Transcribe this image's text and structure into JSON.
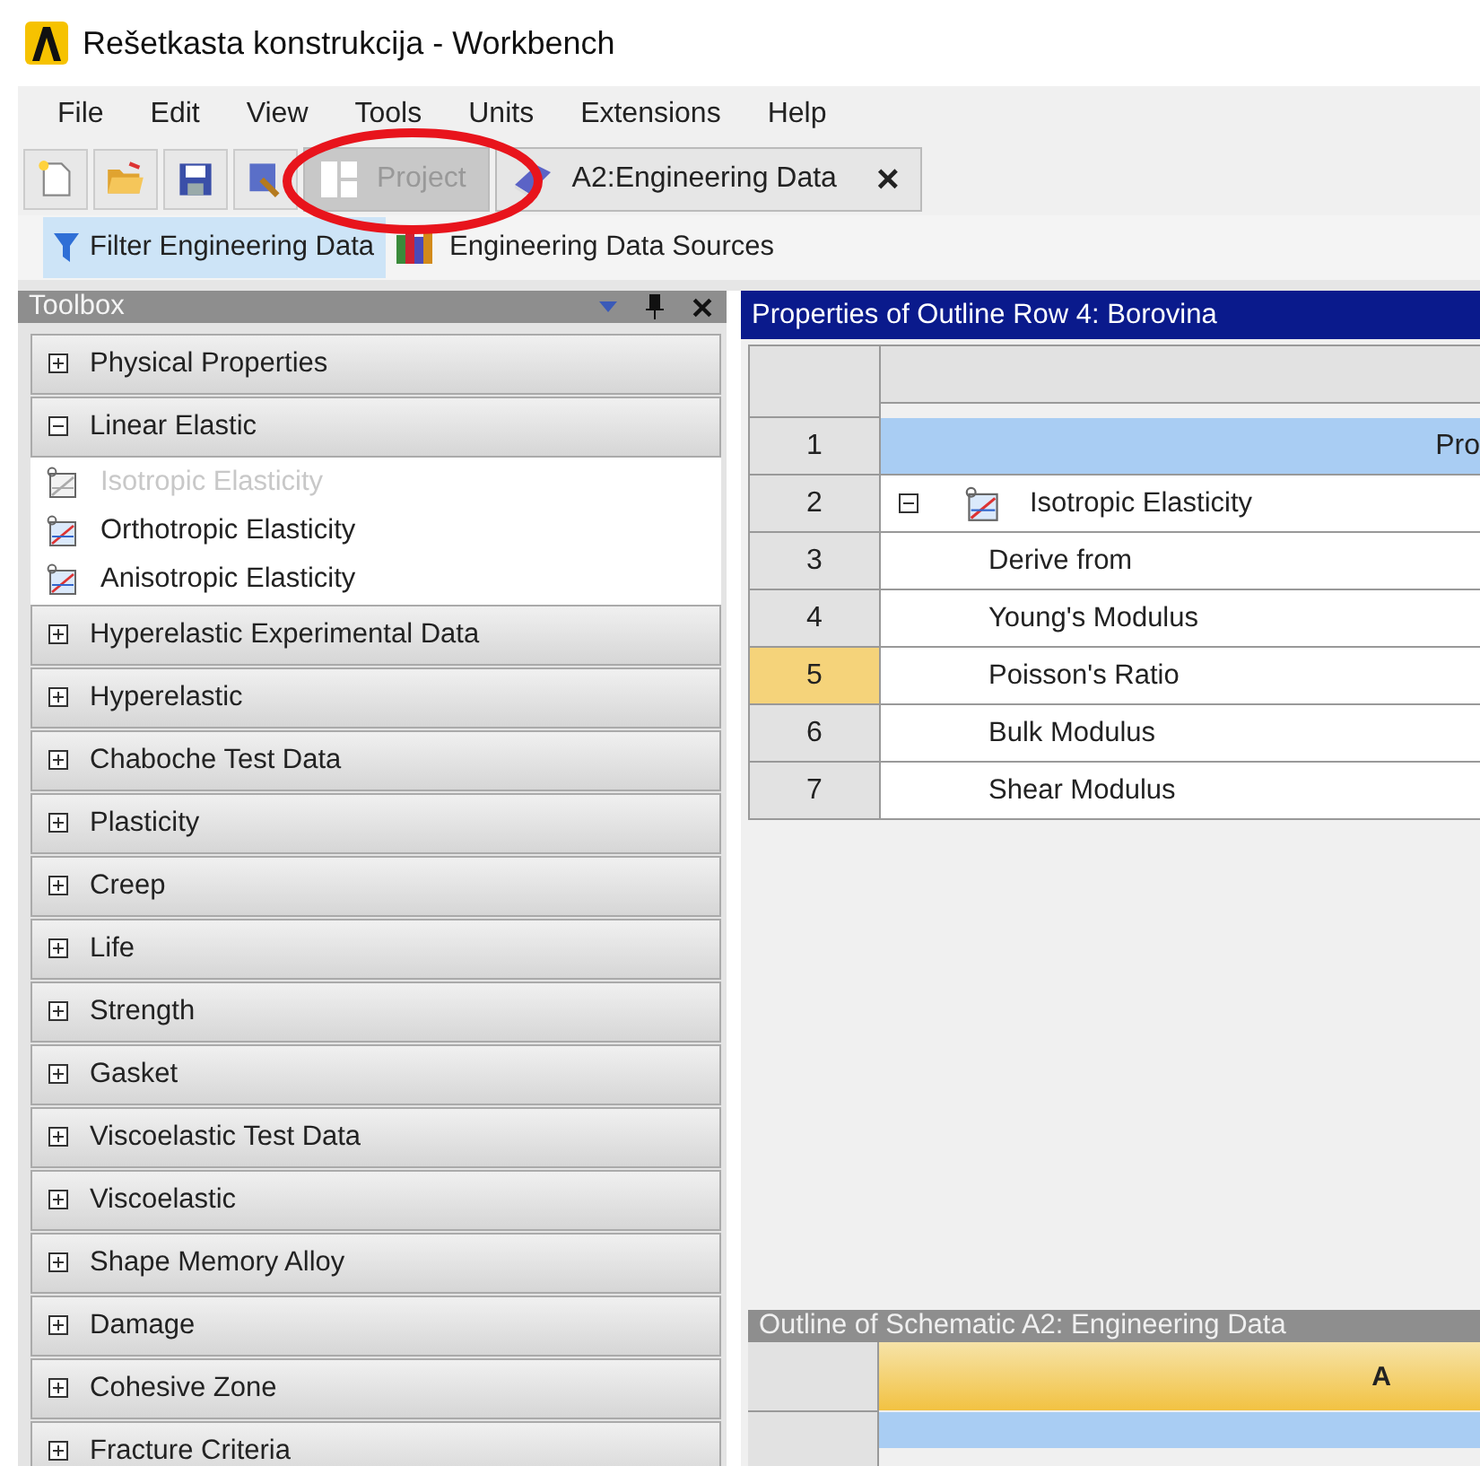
{
  "window": {
    "title": "Rešetkasta konstrukcija - Workbench"
  },
  "menu": [
    "File",
    "Edit",
    "View",
    "Tools",
    "Units",
    "Extensions",
    "Help"
  ],
  "toolbar": {
    "buttons": [
      {
        "kind": "new"
      },
      {
        "kind": "open"
      },
      {
        "kind": "save"
      },
      {
        "kind": "import"
      }
    ],
    "tabs": [
      {
        "label": "Project",
        "selected": false,
        "kind": "project"
      },
      {
        "label": "A2:Engineering Data",
        "selected": true,
        "close": "×",
        "kind": "book"
      }
    ]
  },
  "annotation": {
    "kind": "ellipse"
  },
  "subtoolbar": [
    {
      "label": "Filter Engineering Data",
      "on": true,
      "kind": "filter"
    },
    {
      "label": "Engineering Data Sources",
      "on": false,
      "kind": "books"
    }
  ],
  "toolbox": {
    "title": "Toolbox",
    "items": [
      {
        "kind": "category",
        "label": "Physical Properties",
        "expanded": false
      },
      {
        "kind": "category",
        "label": "Linear Elastic",
        "expanded": true
      },
      {
        "kind": "item",
        "label": "Isotropic Elasticity",
        "disabled": true
      },
      {
        "kind": "item",
        "label": "Orthotropic Elasticity",
        "disabled": false
      },
      {
        "kind": "item",
        "label": "Anisotropic Elasticity",
        "disabled": false
      },
      {
        "kind": "category",
        "label": "Hyperelastic Experimental Data",
        "expanded": false
      },
      {
        "kind": "category",
        "label": "Hyperelastic",
        "expanded": false
      },
      {
        "kind": "category",
        "label": "Chaboche Test Data",
        "expanded": false
      },
      {
        "kind": "category",
        "label": "Plasticity",
        "expanded": false
      },
      {
        "kind": "category",
        "label": "Creep",
        "expanded": false
      },
      {
        "kind": "category",
        "label": "Life",
        "expanded": false
      },
      {
        "kind": "category",
        "label": "Strength",
        "expanded": false
      },
      {
        "kind": "category",
        "label": "Gasket",
        "expanded": false
      },
      {
        "kind": "category",
        "label": "Viscoelastic Test Data",
        "expanded": false
      },
      {
        "kind": "category",
        "label": "Viscoelastic",
        "expanded": false
      },
      {
        "kind": "category",
        "label": "Shape Memory Alloy",
        "expanded": false
      },
      {
        "kind": "category",
        "label": "Damage",
        "expanded": false
      },
      {
        "kind": "category",
        "label": "Cohesive Zone",
        "expanded": false
      },
      {
        "kind": "category",
        "label": "Fracture Criteria",
        "expanded": false
      }
    ]
  },
  "properties": {
    "title": "Properties of Outline Row 4: Borovina",
    "rows": [
      {
        "number": "1",
        "kind": "header",
        "label": "Pro",
        "selected": false
      },
      {
        "number": "2",
        "kind": "group",
        "label": "Isotropic Elasticity",
        "expanded": true,
        "selected": false
      },
      {
        "number": "3",
        "kind": "property",
        "label": "Derive from",
        "selected": false
      },
      {
        "number": "4",
        "kind": "property",
        "label": "Young's Modulus",
        "selected": false
      },
      {
        "number": "5",
        "kind": "property",
        "label": "Poisson's Ratio",
        "selected": true
      },
      {
        "number": "6",
        "kind": "property",
        "label": "Bulk Modulus",
        "selected": false
      },
      {
        "number": "7",
        "kind": "property",
        "label": "Shear Modulus",
        "selected": false
      }
    ]
  },
  "outline": {
    "title": "Outline of Schematic A2: Engineering Data",
    "columns": [
      "A"
    ]
  }
}
